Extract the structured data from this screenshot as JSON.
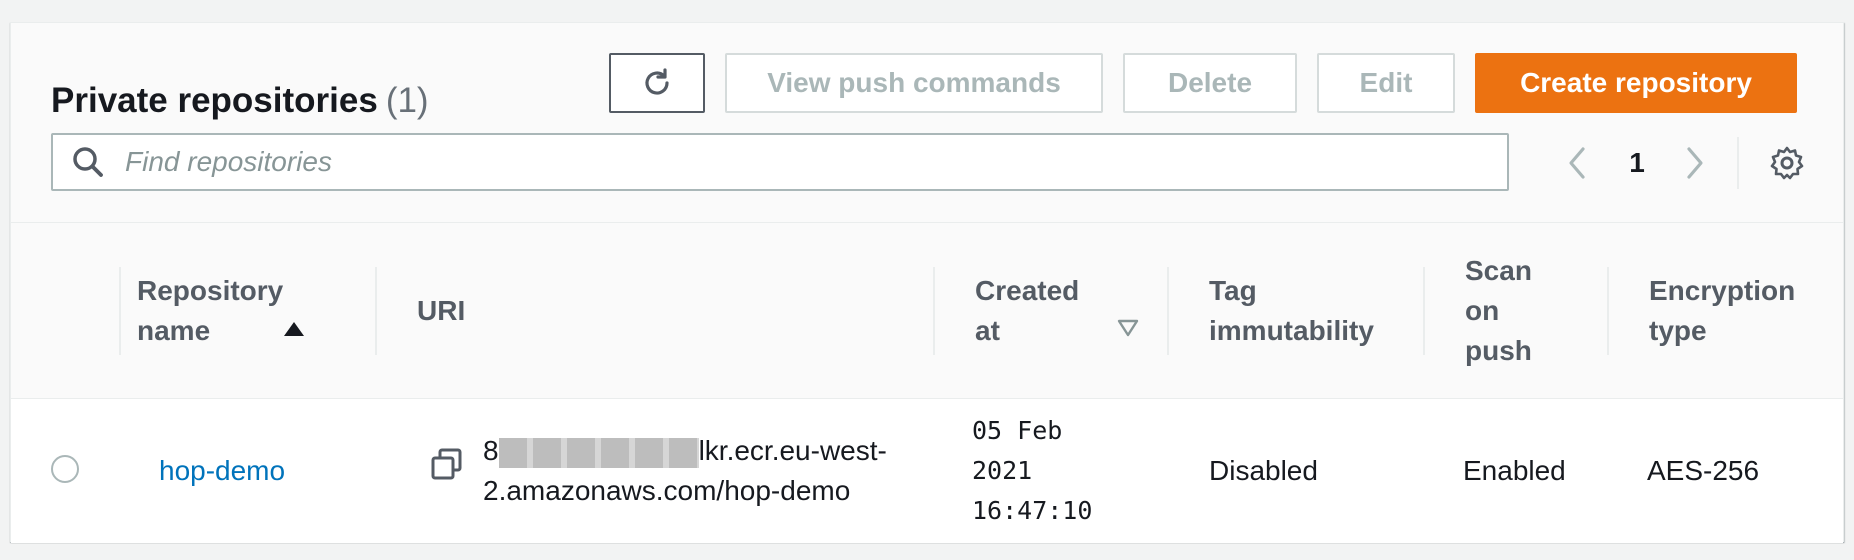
{
  "header": {
    "title": "Private repositories",
    "count": "(1)"
  },
  "toolbar": {
    "refresh_icon": "refresh-icon",
    "view_push_label": "View push commands",
    "delete_label": "Delete",
    "edit_label": "Edit",
    "create_label": "Create repository"
  },
  "search": {
    "placeholder": "Find repositories",
    "icon": "search-icon"
  },
  "pagination": {
    "current_page": "1",
    "prev_icon": "chevron-left-icon",
    "next_icon": "chevron-right-icon",
    "settings_icon": "gear-icon"
  },
  "table": {
    "columns": [
      {
        "line1": "Repository",
        "line2": "name",
        "sort": "ascending"
      },
      {
        "line1": "URI",
        "line2": ""
      },
      {
        "line1": "Created",
        "line2": "at",
        "sort": "descending-inactive"
      },
      {
        "line1": "Tag",
        "line2": "immutability"
      },
      {
        "line1": "Scan",
        "line2": "on",
        "line3": "push"
      },
      {
        "line1": "Encryption",
        "line2": "type"
      }
    ],
    "rows": [
      {
        "selected": false,
        "name": "hop-demo",
        "uri_prefix": "8",
        "uri_line1_suffix": "lkr.ecr.eu-west-",
        "uri_line2": "2.amazonaws.com/hop-demo",
        "created_line1": "05 Feb",
        "created_line2": "2021",
        "created_line3": "16:47:10",
        "tag_immutability": "Disabled",
        "scan_on_push": "Enabled",
        "encryption": "AES-256"
      }
    ]
  },
  "colors": {
    "primary": "#ec7211",
    "link": "#0073bb",
    "disabled_text": "#aab7b8"
  }
}
